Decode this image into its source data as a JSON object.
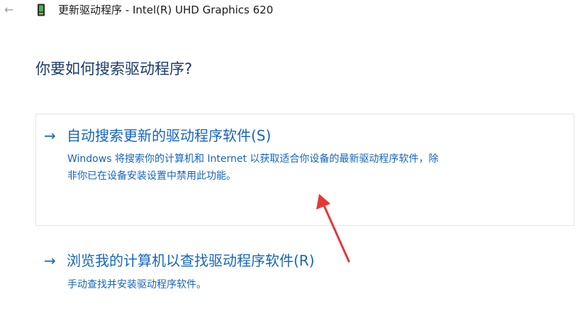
{
  "header": {
    "back_icon": "back-arrow-icon",
    "device_icon": "graphics-card-icon",
    "window_title": "更新驱动程序 - Intel(R) UHD Graphics 620"
  },
  "main": {
    "title": "你要如何搜索驱动程序?",
    "options": [
      {
        "arrow": "→",
        "heading": "自动搜索更新的驱动程序软件(S)",
        "description_line1": "Windows 将搜索你的计算机和 Internet 以获取适合你设备的最新驱动程序软件，除",
        "description_line2": "非你已在设备安装设置中禁用此功能。"
      },
      {
        "arrow": "→",
        "heading": "浏览我的计算机以查找驱动程序软件(R)",
        "description_line1": "手动查找并安装驱动程序软件。"
      }
    ]
  },
  "colors": {
    "accent": "#1565c0",
    "title": "#1c3a6e",
    "annotation": "#e53935"
  }
}
